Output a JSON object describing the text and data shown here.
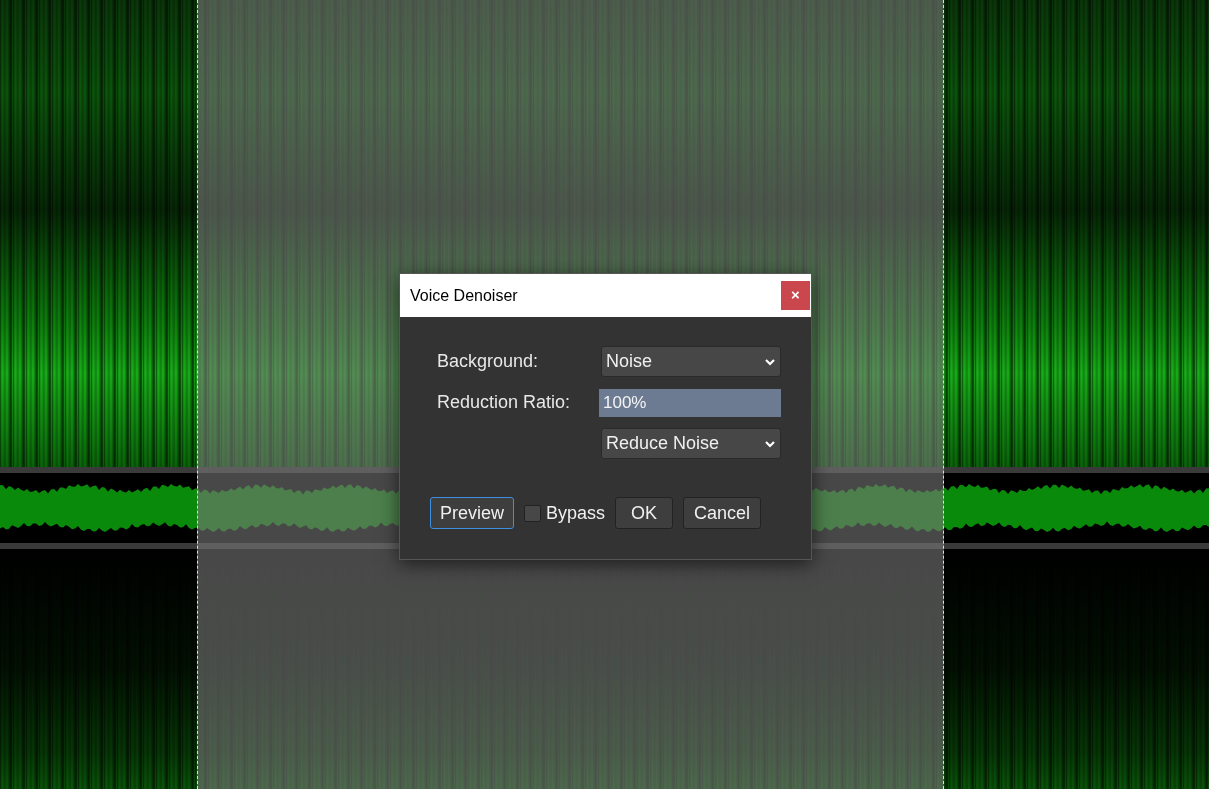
{
  "dialog": {
    "title": "Voice Denoiser",
    "close": "×",
    "fields": [
      {
        "kind": "select",
        "label": "Background:",
        "value": "Noise"
      },
      {
        "kind": "input",
        "label": "Reduction Ratio:",
        "value": "100%"
      },
      {
        "kind": "select",
        "value": "Reduce Noise"
      }
    ],
    "preview": {
      "label": "Preview",
      "focused": true
    },
    "bypass": {
      "label": "Bypass",
      "checked": false
    },
    "buttons": [
      "OK",
      "Cancel"
    ]
  }
}
